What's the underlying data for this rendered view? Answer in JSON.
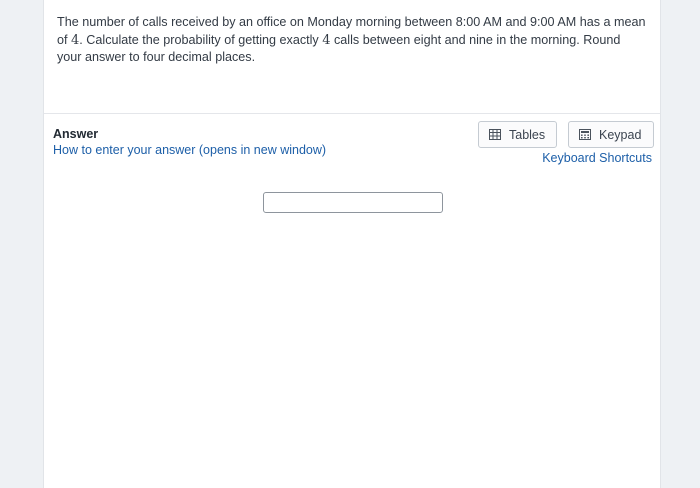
{
  "question": {
    "text_part1": "The number of calls received by an office on Monday morning between 8:00 AM and 9:00 AM has a mean of ",
    "mean_value": "4",
    "text_part2": ". Calculate the probability of getting exactly ",
    "exact_value": "4",
    "text_part3": " calls between eight and nine in the morning. Round your answer to four decimal places."
  },
  "answer": {
    "label": "Answer",
    "help_link": "How to enter your answer (opens in new window)",
    "input_value": ""
  },
  "tools": {
    "tables_label": "Tables",
    "keypad_label": "Keypad",
    "tables_icon": "table-grid-icon",
    "keypad_icon": "calculator-icon",
    "shortcuts_label": "Keyboard Shortcuts"
  },
  "colors": {
    "link": "#1d5fa8",
    "background": "#eef1f4",
    "panel": "#ffffff",
    "text": "#333b45"
  }
}
